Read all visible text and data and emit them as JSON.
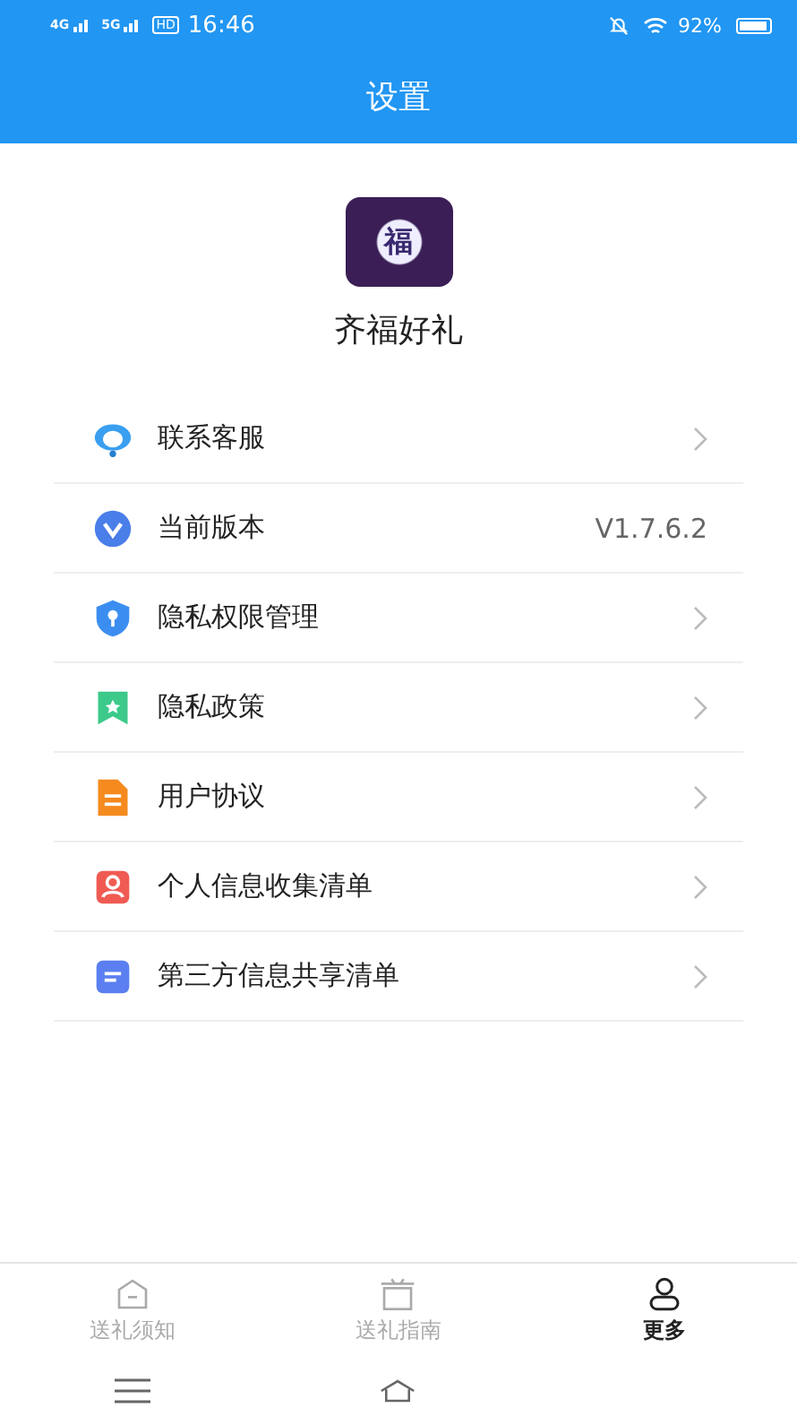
{
  "status_bar": {
    "network_1": "4G",
    "network_2": "5G",
    "hd": "HD",
    "time": "16:46",
    "battery": "92%"
  },
  "header": {
    "title": "设置"
  },
  "app": {
    "logo_text": "福",
    "name": "齐福好礼"
  },
  "settings": [
    {
      "kind": "service",
      "label": "联系客服",
      "chevron": true
    },
    {
      "kind": "version",
      "label": "当前版本",
      "value": "V1.7.6.2",
      "chevron": false
    },
    {
      "kind": "permission",
      "label": "隐私权限管理",
      "chevron": true
    },
    {
      "kind": "policy",
      "label": "隐私政策",
      "chevron": true
    },
    {
      "kind": "agreement",
      "label": "用户协议",
      "chevron": true
    },
    {
      "kind": "personal",
      "label": "个人信息收集清单",
      "chevron": true
    },
    {
      "kind": "sharing",
      "label": "第三方信息共享清单",
      "chevron": true
    }
  ],
  "tabs": [
    {
      "kind": "notice",
      "label": "送礼须知",
      "selected": false
    },
    {
      "kind": "guide",
      "label": "送礼指南",
      "selected": false
    },
    {
      "kind": "more",
      "label": "更多",
      "selected": true
    }
  ]
}
